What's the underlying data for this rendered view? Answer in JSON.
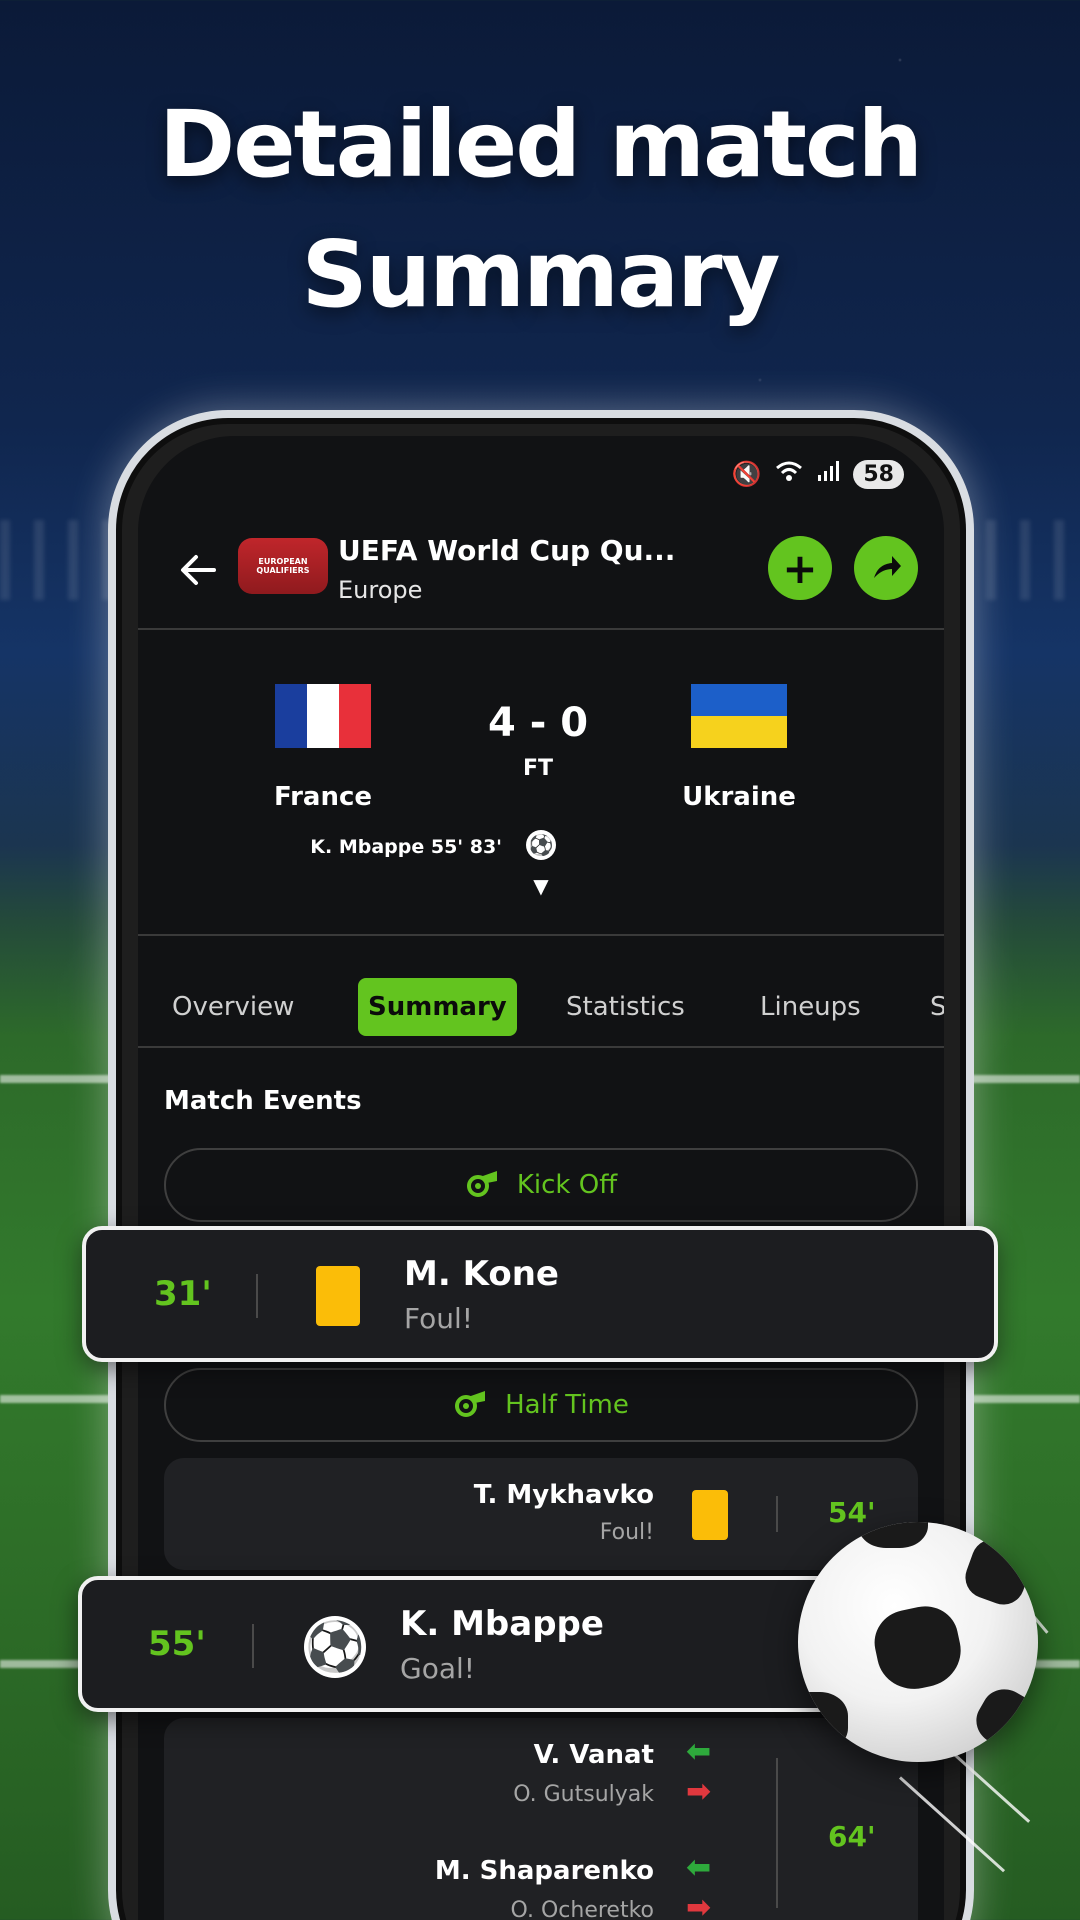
{
  "headline": {
    "line1": "Detailed match",
    "line2": "Summary"
  },
  "statusbar": {
    "mute_icon": "mute-icon",
    "wifi_icon": "wifi-icon",
    "signal_icon": "signal-icon",
    "battery": "58"
  },
  "topbar": {
    "league_name": "UEFA World Cup Qu...",
    "region": "Europe",
    "logo_text": "EUROPEAN QUALIFIERS"
  },
  "match": {
    "home": "France",
    "away": "Ukraine",
    "score": "4 - 0",
    "status": "FT",
    "scorer": "K. Mbappe  55' 83'"
  },
  "tabs": [
    {
      "label": "Overview",
      "active": false
    },
    {
      "label": "Summary",
      "active": true
    },
    {
      "label": "Statistics",
      "active": false
    },
    {
      "label": "Lineups",
      "active": false
    },
    {
      "label": "S",
      "active": false
    }
  ],
  "events_title": "Match Events",
  "kickoff_label": "Kick Off",
  "halftime_label": "Half Time",
  "card_kone": {
    "minute": "31'",
    "player": "M. Kone",
    "type": "Foul!"
  },
  "card_mykhavko": {
    "minute": "54'",
    "player": "T. Mykhavko",
    "type": "Foul!"
  },
  "card_mbappe": {
    "minute": "55'",
    "player": "K. Mbappe",
    "type": "Goal!"
  },
  "subs": {
    "minute": "64'",
    "in1": "V. Vanat",
    "out1": "O. Gutsulyak",
    "in2": "M. Shaparenko",
    "out2": "O. Ocheretko"
  },
  "colors": {
    "accent": "#63c41f",
    "yellow_card": "#fbbd08",
    "sub_in": "#2eaa3c",
    "sub_out": "#e0383e"
  }
}
